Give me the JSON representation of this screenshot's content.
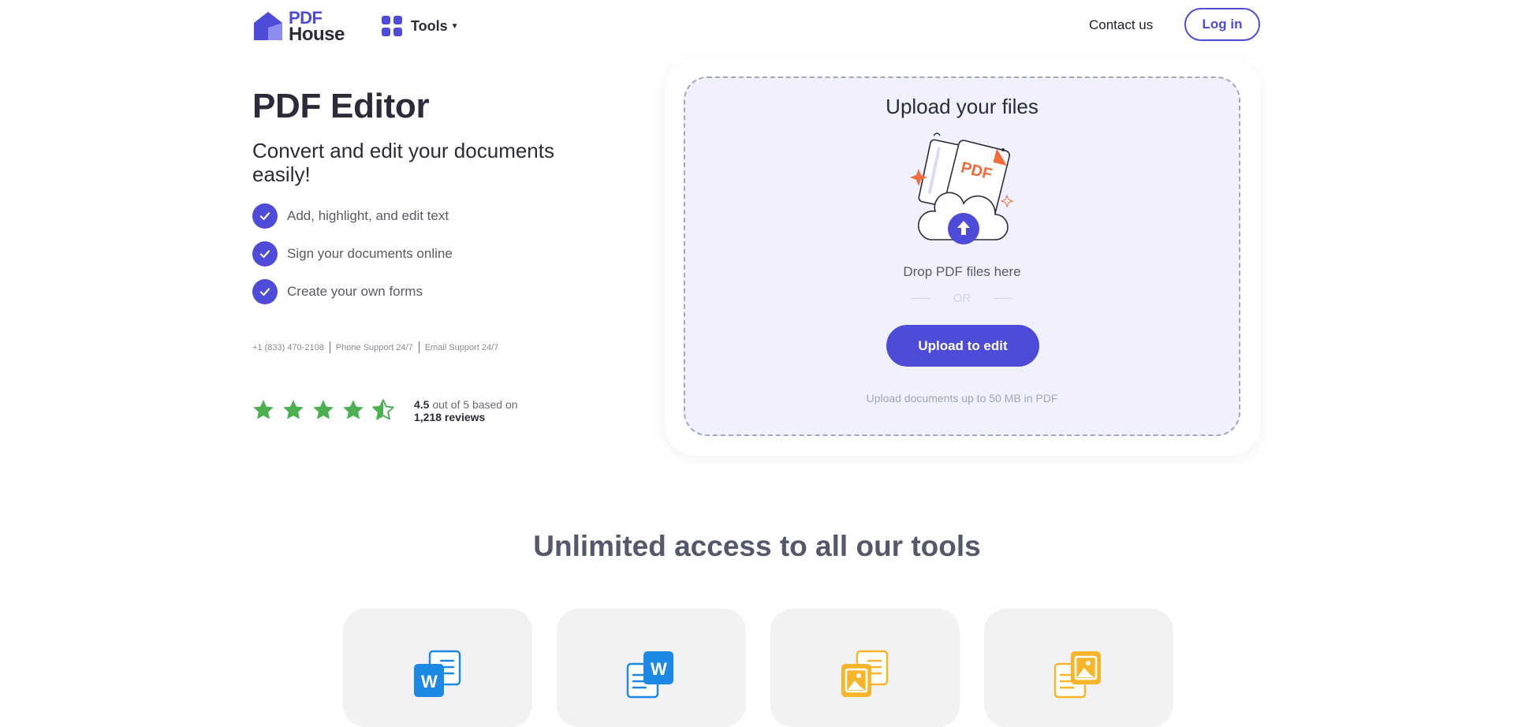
{
  "header": {
    "logo_top": "PDF",
    "logo_bottom": "House",
    "tools_label": "Tools",
    "contact_label": "Contact us",
    "login_label": "Log in"
  },
  "hero": {
    "title": "PDF Editor",
    "subtitle": "Convert and edit your documents easily!",
    "features": [
      "Add, highlight, and edit text",
      "Sign your documents online",
      "Create your own forms"
    ],
    "support": {
      "phone": "+1 (833) 470-2108",
      "phone_support": "Phone Support 24/7",
      "email_support": "Email Support 24/7"
    },
    "rating": {
      "score": "4.5",
      "out_of_text": "out of 5 based on",
      "reviews": "1,218 reviews",
      "stars_value": 4.5,
      "star_color": "#4caf50"
    }
  },
  "upload": {
    "title": "Upload your files",
    "drop_text": "Drop PDF files here",
    "or_text": "OR",
    "button_label": "Upload to edit",
    "limit_text": "Upload documents up to 50 MB in PDF",
    "illustration_badge": "PDF"
  },
  "tools_section": {
    "title": "Unlimited access to all our tools",
    "cards": [
      {
        "name": "pdf-to-word",
        "icon": "word-front-icon",
        "color": "#1e88e5",
        "letter": "W"
      },
      {
        "name": "word-to-pdf",
        "icon": "word-back-icon",
        "color": "#1e88e5",
        "letter": "W"
      },
      {
        "name": "pdf-to-image",
        "icon": "image-front-icon",
        "color": "#f9b52a"
      },
      {
        "name": "image-to-pdf",
        "icon": "image-back-icon",
        "color": "#f9b52a"
      }
    ]
  },
  "colors": {
    "accent": "#4e4bd9",
    "text_dark": "#2b2b3a",
    "drop_zone_bg": "#f0f1fd",
    "word_blue": "#1e88e5",
    "image_yellow": "#f9b52a"
  }
}
